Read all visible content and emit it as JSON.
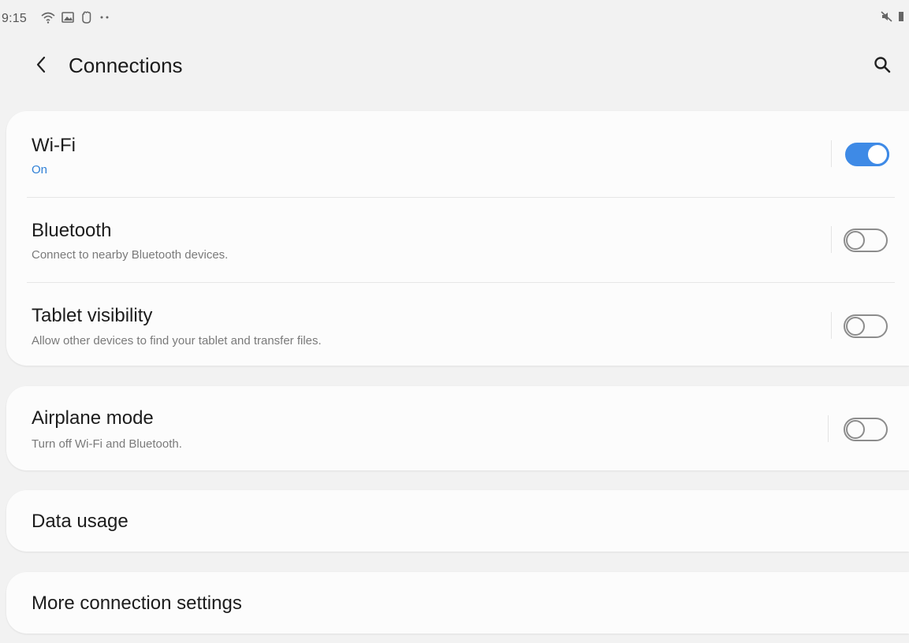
{
  "status_bar": {
    "time": "9:15",
    "icons": [
      "wifi-icon",
      "image-icon",
      "hand-icon",
      "more-dots-icon"
    ],
    "right_icons": [
      "mute-icon",
      "battery-icon"
    ]
  },
  "app_bar": {
    "title": "Connections",
    "back_icon": "chevron-left-icon",
    "search_icon": "search-icon"
  },
  "connections": {
    "wifi": {
      "title": "Wi-Fi",
      "subtitle": "On",
      "enabled": true
    },
    "bluetooth": {
      "title": "Bluetooth",
      "subtitle": "Connect to nearby Bluetooth devices.",
      "enabled": false
    },
    "tablet_visibility": {
      "title": "Tablet visibility",
      "subtitle": "Allow other devices to find your tablet and transfer files.",
      "enabled": false
    }
  },
  "airplane": {
    "title": "Airplane mode",
    "subtitle": "Turn off Wi-Fi and Bluetooth.",
    "enabled": false
  },
  "data_usage": {
    "title": "Data usage"
  },
  "more_settings": {
    "title": "More connection settings"
  },
  "colors": {
    "accent": "#3e8ae6",
    "on_text": "#2f80d6",
    "background": "#f2f2f2",
    "card": "#fcfcfc"
  }
}
